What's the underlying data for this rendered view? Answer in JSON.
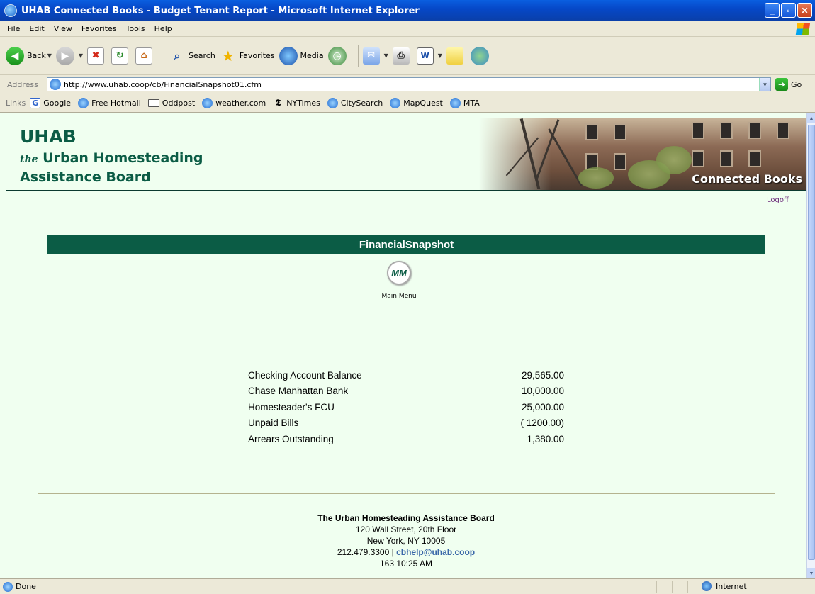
{
  "window": {
    "title": "UHAB Connected Books - Budget Tenant Report - Microsoft Internet Explorer",
    "minimize": "_",
    "maximize": "▫",
    "close": "✕"
  },
  "menu": {
    "items": [
      "File",
      "Edit",
      "View",
      "Favorites",
      "Tools",
      "Help"
    ]
  },
  "toolbar": {
    "back_label": "Back",
    "search_label": "Search",
    "favorites_label": "Favorites",
    "media_label": "Media"
  },
  "address": {
    "label": "Address",
    "url": "http://www.uhab.coop/cb/FinancialSnapshot01.cfm",
    "go_label": "Go"
  },
  "links": {
    "label": "Links",
    "items": [
      "Google",
      "Free Hotmail",
      "Oddpost",
      "weather.com",
      "NYTimes",
      "CitySearch",
      "MapQuest",
      "MTA"
    ]
  },
  "page": {
    "brand_line1": "UHAB",
    "brand_line2_the": "the",
    "brand_line2": " Urban Homesteading",
    "brand_line3": "Assistance Board",
    "banner_caption": "Connected Books",
    "logoff": "Logoff",
    "section_title": "FinancialSnapshot",
    "main_menu_badge": "MM",
    "main_menu_label": "Main Menu",
    "financials": [
      {
        "label": "Checking Account Balance",
        "value": "29,565.00"
      },
      {
        "label": "Chase Manhattan Bank",
        "value": "10,000.00"
      },
      {
        "label": "Homesteader's FCU",
        "value": "25,000.00"
      },
      {
        "label": "Unpaid Bills",
        "value": "( 1200.00)"
      },
      {
        "label": "Arrears Outstanding",
        "value": "1,380.00"
      }
    ],
    "footer": {
      "org": "The Urban Homesteading Assistance Board",
      "address1": "120 Wall Street, 20th Floor",
      "address2": "New York, NY 10005",
      "phone": "212.479.3300 |",
      "email": "cbhelp@uhab.coop",
      "stamp": "163  10:25 AM"
    }
  },
  "status": {
    "text": "Done",
    "zone": "Internet"
  },
  "colors": {
    "brand_green": "#0b5c45",
    "page_bg": "#f0fff0",
    "link_purple": "#6b2a7a",
    "email_blue": "#3a67a8"
  }
}
